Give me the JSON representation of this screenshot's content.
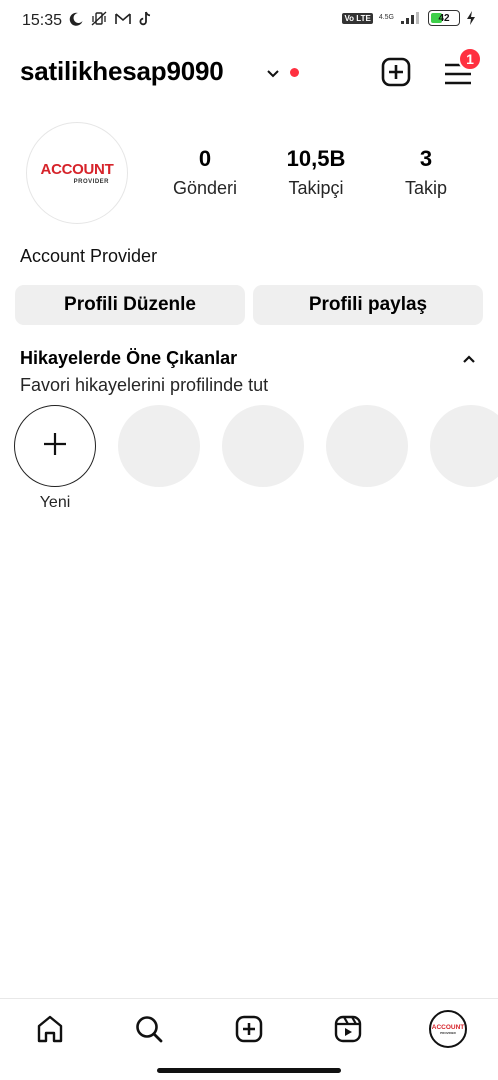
{
  "status_bar": {
    "time": "15:35",
    "volte": "Vo LTE",
    "network": "4.5G",
    "battery": "42",
    "battery_level_percent": 42,
    "icons_left": [
      "moon-icon",
      "vibrate-off-icon",
      "gmail-icon",
      "tiktok-icon"
    ],
    "icons_right": [
      "volte-icon",
      "signal-icon",
      "battery-icon",
      "charging-icon"
    ]
  },
  "header": {
    "username": "satilikhesap9090",
    "menu_badge_count": "1",
    "icons": [
      "chevron-down-icon",
      "new-post-icon",
      "menu-icon"
    ]
  },
  "profile": {
    "avatar_logo_text": "ACCOUNT",
    "avatar_logo_sub": "PROVIDER",
    "stats": [
      {
        "value": "0",
        "label": "Gönderi"
      },
      {
        "value": "10,5B",
        "label": "Takipçi"
      },
      {
        "value": "3",
        "label": "Takip"
      }
    ],
    "display_name": "Account Provider"
  },
  "buttons": {
    "edit_profile": "Profili Düzenle",
    "share_profile": "Profili paylaş"
  },
  "highlights": {
    "title": "Hikayelerde Öne Çıkanlar",
    "subtitle": "Favori hikayelerini profilinde tut",
    "new_label": "Yeni"
  },
  "bottom_nav": {
    "items": [
      "home-icon",
      "search-icon",
      "create-icon",
      "reels-icon",
      "profile-avatar"
    ]
  },
  "colors": {
    "accent_red": "#ff3040",
    "button_bg": "#efefef",
    "logo_red": "#d6232a"
  }
}
